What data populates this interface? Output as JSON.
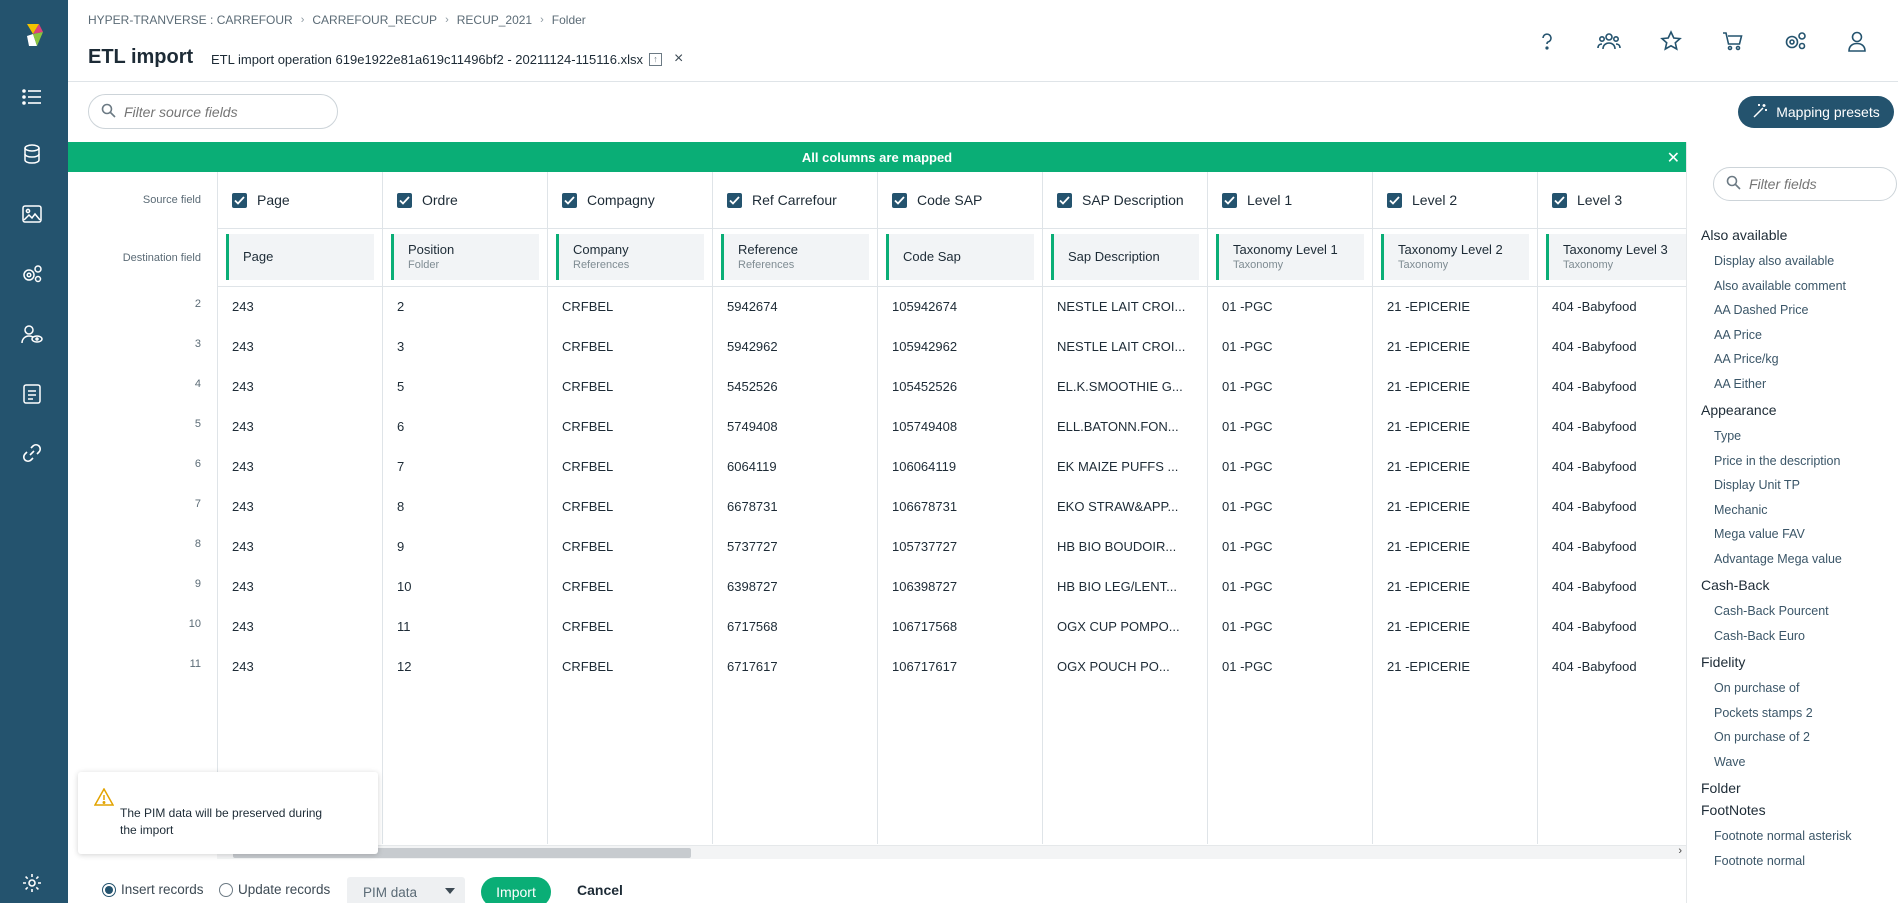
{
  "breadcrumb": [
    "HYPER-TRANVERSE : CARREFOUR",
    "CARREFOUR_RECUP",
    "RECUP_2021",
    "Folder"
  ],
  "page_title": "ETL import",
  "file_name": "ETL import operation 619e1922e81a619c11496bf2 - 20211124-115116.xlsx",
  "search": {
    "placeholder": "Filter source fields"
  },
  "presets_button": "Mapping presets",
  "banner": "All columns are mapped",
  "gutter": {
    "source_label": "Source field",
    "destination_label": "Destination field",
    "row_numbers": [
      "2",
      "3",
      "4",
      "5",
      "6",
      "7",
      "8",
      "9",
      "10",
      "11"
    ]
  },
  "columns": [
    {
      "source": "Page",
      "dest": "Page",
      "dest_sub": "",
      "cells": [
        "243",
        "243",
        "243",
        "243",
        "243",
        "243",
        "243",
        "243",
        "243",
        "243"
      ]
    },
    {
      "source": "Ordre",
      "dest": "Position",
      "dest_sub": "Folder",
      "cells": [
        "2",
        "3",
        "5",
        "6",
        "7",
        "8",
        "9",
        "10",
        "11",
        "12"
      ]
    },
    {
      "source": "Compagny",
      "dest": "Company",
      "dest_sub": "References",
      "cells": [
        "CRFBEL",
        "CRFBEL",
        "CRFBEL",
        "CRFBEL",
        "CRFBEL",
        "CRFBEL",
        "CRFBEL",
        "CRFBEL",
        "CRFBEL",
        "CRFBEL"
      ]
    },
    {
      "source": "Ref Carrefour",
      "dest": "Reference",
      "dest_sub": "References",
      "cells": [
        "5942674",
        "5942962",
        "5452526",
        "5749408",
        "6064119",
        "6678731",
        "5737727",
        "6398727",
        "6717568",
        "6717617"
      ]
    },
    {
      "source": "Code SAP",
      "dest": "Code Sap",
      "dest_sub": "",
      "cells": [
        "105942674",
        "105942962",
        "105452526",
        "105749408",
        "106064119",
        "106678731",
        "105737727",
        "106398727",
        "106717568",
        "106717617"
      ]
    },
    {
      "source": "SAP Description",
      "dest": "Sap Description",
      "dest_sub": "",
      "cells": [
        "NESTLE LAIT CROI...",
        "NESTLE LAIT CROI...",
        "EL.K.SMOOTHIE G...",
        "ELL.BATONN.FON...",
        "EK MAIZE PUFFS ...",
        "EKO STRAW&APP...",
        "HB BIO BOUDOIR...",
        "HB BIO LEG/LENT...",
        "OGX CUP POMPO...",
        "OGX POUCH PO..."
      ]
    },
    {
      "source": "Level 1",
      "dest": "Taxonomy Level 1",
      "dest_sub": "Taxonomy",
      "cells": [
        "01 -PGC",
        "01 -PGC",
        "01 -PGC",
        "01 -PGC",
        "01 -PGC",
        "01 -PGC",
        "01 -PGC",
        "01 -PGC",
        "01 -PGC",
        "01 -PGC"
      ]
    },
    {
      "source": "Level 2",
      "dest": "Taxonomy Level 2",
      "dest_sub": "Taxonomy",
      "cells": [
        "21 -EPICERIE",
        "21 -EPICERIE",
        "21 -EPICERIE",
        "21 -EPICERIE",
        "21 -EPICERIE",
        "21 -EPICERIE",
        "21 -EPICERIE",
        "21 -EPICERIE",
        "21 -EPICERIE",
        "21 -EPICERIE"
      ]
    },
    {
      "source": "Level 3",
      "dest": "Taxonomy Level 3",
      "dest_sub": "Taxonomy",
      "cells": [
        "404 -Babyfood",
        "404 -Babyfood",
        "404 -Babyfood",
        "404 -Babyfood",
        "404 -Babyfood",
        "404 -Babyfood",
        "404 -Babyfood",
        "404 -Babyfood",
        "404 -Babyfood",
        "404 -Babyfood"
      ]
    }
  ],
  "right_panel": {
    "placeholder": "Filter fields",
    "groups": [
      {
        "name": "Also available",
        "items": [
          "Display also available",
          "Also available comment",
          "AA Dashed Price",
          "AA Price",
          "AA Price/kg",
          "AA Either"
        ]
      },
      {
        "name": "Appearance",
        "items": [
          "Type",
          "Price in the description",
          "Display Unit TP",
          "Mechanic",
          "Mega value FAV",
          "Advantage Mega value"
        ]
      },
      {
        "name": "Cash-Back",
        "items": [
          "Cash-Back Pourcent",
          "Cash-Back Euro"
        ]
      },
      {
        "name": "Fidelity",
        "items": [
          "On purchase of",
          "Pockets stamps 2",
          "On purchase of 2",
          "Wave"
        ]
      },
      {
        "name": "Folder",
        "items": []
      },
      {
        "name": "FootNotes",
        "items": [
          "Footnote normal asterisk",
          "Footnote normal"
        ]
      }
    ]
  },
  "toast": "The PIM data will be preserved during the import",
  "footer": {
    "insert": "Insert records",
    "update": "Update records",
    "select": "PIM data",
    "import": "Import",
    "cancel": "Cancel"
  },
  "colors": {
    "rail": "#24536e",
    "accent_green": "#0aae76",
    "primary_blue": "#24536e"
  }
}
